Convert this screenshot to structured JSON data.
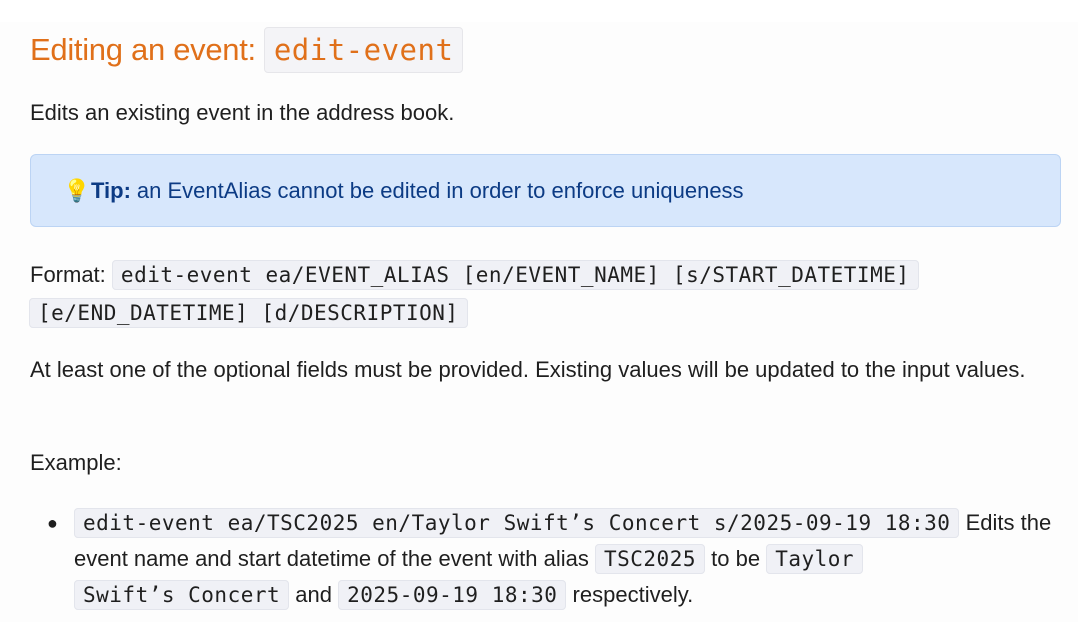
{
  "heading": {
    "text": "Editing an event:",
    "command": "edit-event"
  },
  "description": "Edits an existing event in the address book.",
  "tip": {
    "icon": "lightbulb-icon",
    "icon_glyph": "💡",
    "label": "Tip:",
    "text": "an EventAlias cannot be edited in order to enforce uniqueness"
  },
  "format": {
    "label": "Format:",
    "line1": "edit-event ea/EVENT_ALIAS [en/EVENT_NAME] [s/START_DATETIME]",
    "line2": "[e/END_DATETIME] [d/DESCRIPTION]"
  },
  "note": "At least one of the optional fields must be provided. Existing values will be updated to the input values.",
  "example_label": "Example:",
  "examples": [
    {
      "command": "edit-event ea/TSC2025 en/Taylor Swift’s Concert s/2025-09-19 18:30",
      "text1": "Edits the event name and start datetime of the event with alias",
      "code1": "TSC2025",
      "text2": "to be",
      "code2a": "Taylor",
      "code2b": "Swift’s Concert",
      "text3": "and",
      "code3": "2025-09-19 18:30",
      "text4": "respectively."
    }
  ],
  "colors": {
    "heading": "#e0701a",
    "tip_background": "#d7e7fc",
    "tip_text": "#0c3b84",
    "code_background": "#f0f1f6"
  }
}
